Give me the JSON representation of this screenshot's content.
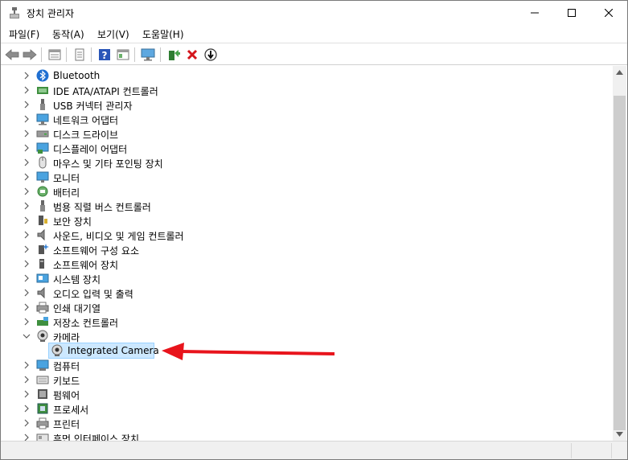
{
  "window": {
    "title": "장치 관리자",
    "minimize_icon": "minimize-icon",
    "maximize_icon": "maximize-icon",
    "close_icon": "close-icon"
  },
  "menu": [
    {
      "label": "파일(F)"
    },
    {
      "label": "동작(A)"
    },
    {
      "label": "보기(V)"
    },
    {
      "label": "도움말(H)"
    }
  ],
  "toolbar": [
    "back-icon",
    "forward-icon",
    "properties-view-icon",
    "properties-icon",
    "help-icon",
    "action-view-icon",
    "scan-hardware-icon",
    "update-driver-icon",
    "uninstall-icon",
    "disable-device-icon"
  ],
  "tree": {
    "items": [
      {
        "label": "Bluetooth",
        "icon": "bluetooth-icon",
        "expanded": false
      },
      {
        "label": "IDE ATA/ATAPI 컨트롤러",
        "icon": "ide-controller-icon",
        "expanded": false
      },
      {
        "label": "USB 커넥터 관리자",
        "icon": "usb-icon",
        "expanded": false
      },
      {
        "label": "네트워크 어댑터",
        "icon": "network-adapter-icon",
        "expanded": false
      },
      {
        "label": "디스크 드라이브",
        "icon": "disk-drive-icon",
        "expanded": false
      },
      {
        "label": "디스플레이 어댑터",
        "icon": "display-adapter-icon",
        "expanded": false
      },
      {
        "label": "마우스 및 기타 포인팅 장치",
        "icon": "mouse-icon",
        "expanded": false
      },
      {
        "label": "모니터",
        "icon": "monitor-icon",
        "expanded": false
      },
      {
        "label": "배터리",
        "icon": "battery-icon",
        "expanded": false
      },
      {
        "label": "범용 직렬 버스 컨트롤러",
        "icon": "usb-controller-icon",
        "expanded": false
      },
      {
        "label": "보안 장치",
        "icon": "security-device-icon",
        "expanded": false
      },
      {
        "label": "사운드, 비디오 및 게임 컨트롤러",
        "icon": "speaker-icon",
        "expanded": false
      },
      {
        "label": "소프트웨어 구성 요소",
        "icon": "software-component-icon",
        "expanded": false
      },
      {
        "label": "소프트웨어 장치",
        "icon": "software-device-icon",
        "expanded": false
      },
      {
        "label": "시스템 장치",
        "icon": "system-device-icon",
        "expanded": false
      },
      {
        "label": "오디오 입력 및 출력",
        "icon": "audio-icon",
        "expanded": false
      },
      {
        "label": "인쇄 대기열",
        "icon": "print-queue-icon",
        "expanded": false
      },
      {
        "label": "저장소 컨트롤러",
        "icon": "storage-controller-icon",
        "expanded": false
      },
      {
        "label": "카메라",
        "icon": "camera-icon",
        "expanded": true
      },
      {
        "label": "Integrated Camera",
        "icon": "webcam-icon",
        "child": true,
        "selected": true
      },
      {
        "label": "컴퓨터",
        "icon": "computer-icon",
        "expanded": false
      },
      {
        "label": "키보드",
        "icon": "keyboard-icon",
        "expanded": false
      },
      {
        "label": "펌웨어",
        "icon": "firmware-icon",
        "expanded": false
      },
      {
        "label": "프로세서",
        "icon": "processor-icon",
        "expanded": false
      },
      {
        "label": "프린터",
        "icon": "printer-icon",
        "expanded": false
      },
      {
        "label": "휴먼 인터페이스 장치",
        "icon": "hid-icon",
        "expanded": false
      }
    ]
  },
  "colors": {
    "selection_bg": "#cce8ff",
    "selection_border": "#99d1ff",
    "annotation_arrow": "#e8141c"
  }
}
